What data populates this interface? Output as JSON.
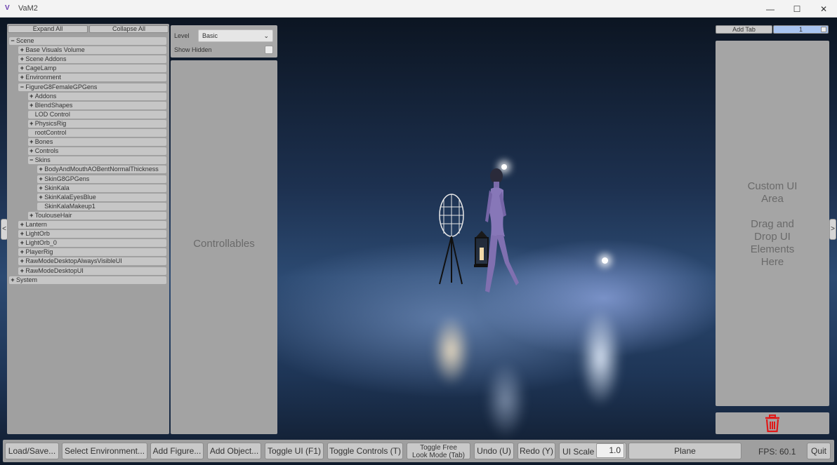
{
  "window": {
    "logo": "V",
    "title": "VaM2",
    "minimize": "—",
    "maximize": "☐",
    "close": "✕"
  },
  "hierarchy": {
    "expand_all": "Expand All",
    "collapse_all": "Collapse All",
    "nodes": [
      {
        "label": "Scene",
        "toggle": "−",
        "depth": 0
      },
      {
        "label": "Base Visuals Volume",
        "toggle": "+",
        "depth": 1
      },
      {
        "label": "Scene Addons",
        "toggle": "+",
        "depth": 1
      },
      {
        "label": "CageLamp",
        "toggle": "+",
        "depth": 1
      },
      {
        "label": "Environment",
        "toggle": "+",
        "depth": 1
      },
      {
        "label": "FigureG8FemaleGPGens",
        "toggle": "−",
        "depth": 1
      },
      {
        "label": "Addons",
        "toggle": "+",
        "depth": 2
      },
      {
        "label": "BlendShapes",
        "toggle": "+",
        "depth": 2
      },
      {
        "label": "LOD Control",
        "toggle": "",
        "depth": 2
      },
      {
        "label": "PhysicsRig",
        "toggle": "+",
        "depth": 2
      },
      {
        "label": "rootControl",
        "toggle": "",
        "depth": 2
      },
      {
        "label": "Bones",
        "toggle": "+",
        "depth": 2
      },
      {
        "label": "Controls",
        "toggle": "+",
        "depth": 2
      },
      {
        "label": "Skins",
        "toggle": "−",
        "depth": 2
      },
      {
        "label": "BodyAndMouthAOBentNormalThickness",
        "toggle": "+",
        "depth": 3
      },
      {
        "label": "SkinG8GPGens",
        "toggle": "+",
        "depth": 3
      },
      {
        "label": "SkinKala",
        "toggle": "+",
        "depth": 3
      },
      {
        "label": "SkinKalaEyesBlue",
        "toggle": "+",
        "depth": 3
      },
      {
        "label": "SkinKalaMakeup1",
        "toggle": "",
        "depth": 3
      },
      {
        "label": "ToulouseHair",
        "toggle": "+",
        "depth": 2
      },
      {
        "label": "Lantern",
        "toggle": "+",
        "depth": 1
      },
      {
        "label": "LightOrb",
        "toggle": "+",
        "depth": 1
      },
      {
        "label": "LightOrb_0",
        "toggle": "+",
        "depth": 1
      },
      {
        "label": "PlayerRig",
        "toggle": "+",
        "depth": 1
      },
      {
        "label": "RawModeDesktopAlwaysVisibleUI",
        "toggle": "+",
        "depth": 1
      },
      {
        "label": "RawModeDesktopUI",
        "toggle": "+",
        "depth": 1
      },
      {
        "label": "System",
        "toggle": "+",
        "depth": 0
      }
    ]
  },
  "filters": {
    "level_label": "Level",
    "level_value": "Basic",
    "show_hidden_label": "Show Hidden"
  },
  "controllables": {
    "title": "Controllables"
  },
  "side_arrows": {
    "left": "<",
    "right": ">"
  },
  "tabs": {
    "add_tab": "Add Tab",
    "tab_1": "1"
  },
  "custom_ui": {
    "line1": "Custom UI",
    "line2": "Area",
    "line3": "Drag and",
    "line4": "Drop UI",
    "line5": "Elements",
    "line6": "Here"
  },
  "toolbar": {
    "load_save": "Load/Save...",
    "select_environment": "Select Environment...",
    "add_figure": "Add Figure...",
    "add_object": "Add Object...",
    "toggle_ui": "Toggle UI (F1)",
    "toggle_controls": "Toggle Controls (T)",
    "toggle_free_line1": "Toggle Free",
    "toggle_free_line2": "Look Mode (Tab)",
    "undo": "Undo (U)",
    "redo": "Redo (Y)",
    "ui_scale_label": "UI Scale",
    "ui_scale_value": "1.0",
    "plane": "Plane",
    "fps": "FPS: 60.1",
    "quit": "Quit"
  },
  "icons": {
    "trash": "trash-icon",
    "trash_color": "#e01818"
  }
}
